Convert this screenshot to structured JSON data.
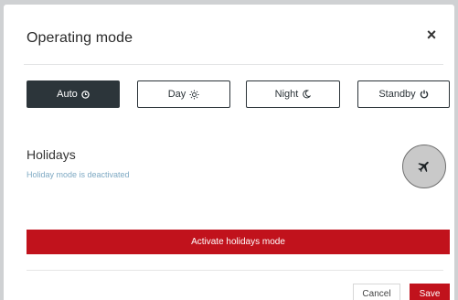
{
  "dialog": {
    "title": "Operating mode",
    "close_glyph": "×"
  },
  "modes": [
    {
      "label": "Auto",
      "icon": "clock-icon",
      "active": true
    },
    {
      "label": "Day",
      "icon": "sun-icon",
      "active": false
    },
    {
      "label": "Night",
      "icon": "moon-icon",
      "active": false
    },
    {
      "label": "Standby",
      "icon": "power-icon",
      "active": false
    }
  ],
  "holidays": {
    "title": "Holidays",
    "status": "Holiday mode is deactivated",
    "toggle_icon": "airplane-icon",
    "activate_label": "Activate holidays mode"
  },
  "footer": {
    "cancel_label": "Cancel",
    "save_label": "Save"
  },
  "colors": {
    "accent": "#c1121c",
    "active_mode": "#2c353a",
    "status_text": "#7ea9c3"
  }
}
